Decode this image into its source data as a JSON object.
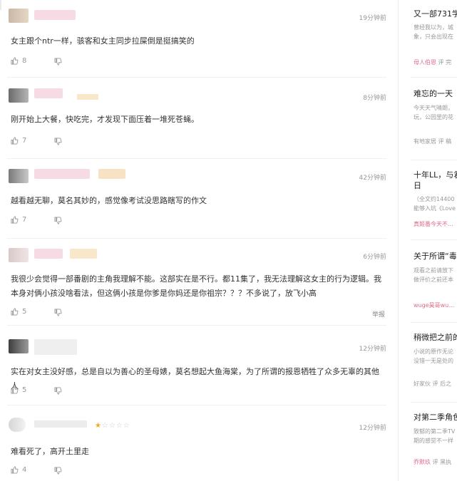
{
  "comments": [
    {
      "time": "19分钟前",
      "text": "女主跟个ntr一样，骇客和女主同步拉屎倒是挺搞笑的",
      "likes": "8"
    },
    {
      "time": "8分钟前",
      "text": "刚开始上大餐，快吃完，才发现下面压着一堆死苍蝇。",
      "likes": "7"
    },
    {
      "time": "42分钟前",
      "text": "越看越无聊，莫名其妙的，感觉像考试没思路瞎写的作文",
      "likes": "7"
    },
    {
      "time": "6分钟前",
      "text": "我很少会觉得一部番剧的主角我理解不能。这部实在是不行。都11集了，我无法理解这女主的行为逻辑。我本身对俩小孩没啥看法，但这俩小孩是你爹是你妈还是你祖宗？？？不多说了，放飞小高",
      "likes": "5",
      "report": "举报"
    },
    {
      "time": "12分钟前",
      "text": "实在对女主没好感，总是自以为善心的圣母婊，莫名想起大鱼海棠，为了所谓的报恩牺牲了众多无辜的其他人",
      "likes": "5"
    },
    {
      "time": "12分钟前",
      "text": "难看死了，高开土里走",
      "likes": "4",
      "stars": "★☆☆☆☆"
    }
  ],
  "sidebar": [
    {
      "title": "又一部731学",
      "desc1": "曾经我以为，城",
      "desc2": "象，只会出现在",
      "author": "母人伯恩",
      "meta": "评  完"
    },
    {
      "title": "难忘的一天",
      "desc1": "今天天气晴朗，",
      "desc2": "玩，公园里的花",
      "author": "有地家居",
      "meta": "评  稿"
    },
    {
      "title": "十年LL，与君",
      "title2": "日",
      "desc1": "（全文约14400",
      "desc2": "能够入坑《Love",
      "author": "真姬番今天不...",
      "meta": ""
    },
    {
      "title": "关于所谓“毒",
      "desc1": "观看之前请放下",
      "desc2": "做评价之前还本",
      "author": "wuge昊哥wu...",
      "meta": ""
    },
    {
      "title": "稍微把之前的",
      "desc1": "小说的原作无论",
      "desc2": "没错一无是处的",
      "author": "好家伙",
      "meta": "评  后之"
    },
    {
      "title": "对第二季角色",
      "desc1": "致郁的第二季TV",
      "desc2": "期的感觉不一样",
      "author": "乔默玖",
      "meta": "评  黑执"
    }
  ],
  "colors": {
    "accent": "#e06b8b",
    "star": "#f5a623"
  }
}
